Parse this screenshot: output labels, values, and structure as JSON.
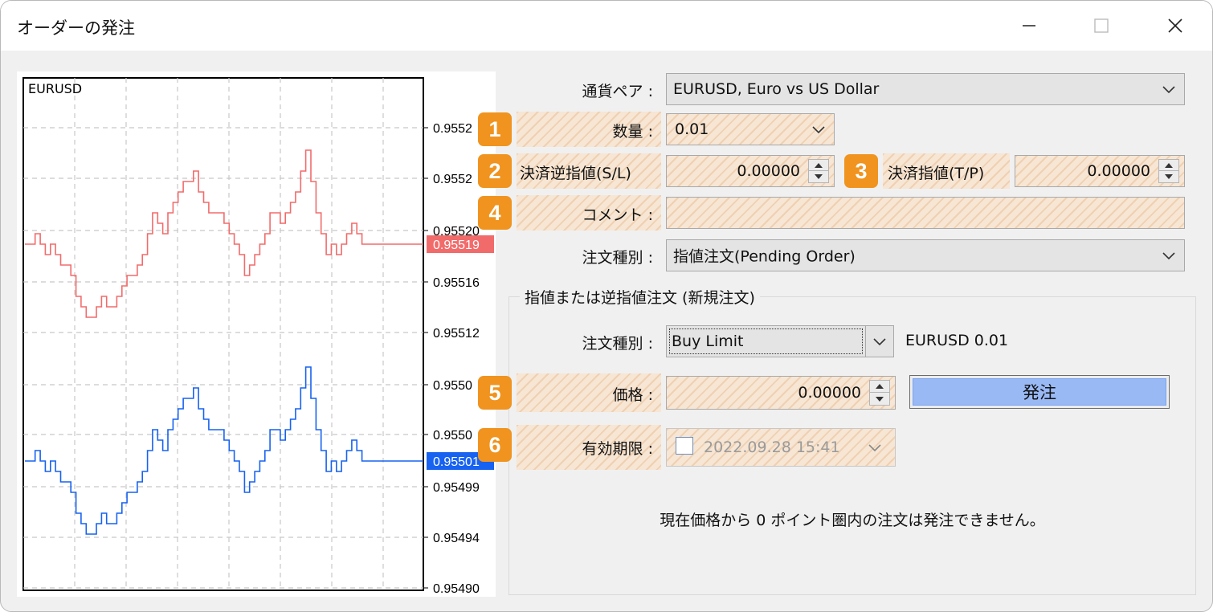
{
  "window": {
    "title": "オーダーの発注",
    "minimize_icon": "minimize-icon",
    "maximize_icon": "maximize-icon",
    "close_icon": "close-icon"
  },
  "colors": {
    "bid_line": "#f26b6b",
    "ask_line": "#1762f0",
    "badge": "#f0941f",
    "order_button": "#99b9f5"
  },
  "badges": [
    "1",
    "2",
    "3",
    "4",
    "5",
    "6"
  ],
  "form": {
    "symbol_label": "通貨ペア :",
    "symbol_value": "EURUSD, Euro vs US Dollar",
    "volume_label": "数量 :",
    "volume_value": "0.01",
    "sl_label": "決済逆指値(S/L)",
    "sl_value": "0.00000",
    "tp_label": "決済指値(T/P)",
    "tp_value": "0.00000",
    "comment_label": "コメント :",
    "comment_value": "",
    "type_label": "注文種別 :",
    "type_value": "指値注文(Pending Order)"
  },
  "pending": {
    "group_title": "指値または逆指値注文 (新規注文)",
    "order_type_label": "注文種別 :",
    "order_type_value": "Buy Limit",
    "order_summary": "EURUSD 0.01",
    "price_label": "価格 :",
    "price_value": "0.00000",
    "place_button": "発注",
    "expiry_label": "有効期限 :",
    "expiry_checked": false,
    "expiry_value": "2022.09.28 15:41",
    "notice": "現在価格から 0 ポイント圏内の注文は発注できません。"
  },
  "chart_data": {
    "type": "line",
    "title": "EURUSD",
    "y_ticks": [
      "0.95524",
      "0.95520",
      "0.95516",
      "0.95512",
      "0.95503",
      "0.95499",
      "0.95494",
      "0.95490"
    ],
    "y_tick_labels_display": [
      "0.9552",
      "0.9552",
      "0.95520",
      "0.95516",
      "0.95512",
      "0.9550",
      "0.9550",
      "0.95499",
      "0.95494",
      "0.95490"
    ],
    "bid_label": "0.95519",
    "ask_label": "0.95501",
    "grid": true,
    "series": [
      {
        "name": "Bid",
        "values": [
          0.95519,
          0.95519,
          0.9552,
          0.95519,
          0.95518,
          0.95519,
          0.95518,
          0.95517,
          0.95517,
          0.95516,
          0.95514,
          0.95513,
          0.95512,
          0.95512,
          0.95513,
          0.95514,
          0.95513,
          0.95513,
          0.95514,
          0.95515,
          0.95516,
          0.95516,
          0.95517,
          0.95518,
          0.9552,
          0.95522,
          0.95521,
          0.9552,
          0.95522,
          0.95523,
          0.95524,
          0.95525,
          0.95525,
          0.95526,
          0.95524,
          0.95523,
          0.95522,
          0.95522,
          0.95522,
          0.95521,
          0.9552,
          0.95519,
          0.95518,
          0.95516,
          0.95517,
          0.95518,
          0.95519,
          0.9552,
          0.95522,
          0.95522,
          0.95521,
          0.95522,
          0.95523,
          0.95524,
          0.95526,
          0.95528,
          0.95525,
          0.95522,
          0.9552,
          0.95518,
          0.95519,
          0.95518,
          0.95519,
          0.9552,
          0.95521,
          0.9552,
          0.95519,
          0.95519,
          0.95519,
          0.95519,
          0.95519
        ]
      },
      {
        "name": "Ask",
        "values": [
          0.95501,
          0.95501,
          0.95502,
          0.95501,
          0.955,
          0.95501,
          0.955,
          0.95499,
          0.95499,
          0.95498,
          0.95496,
          0.95495,
          0.95494,
          0.95494,
          0.95495,
          0.95496,
          0.95495,
          0.95495,
          0.95496,
          0.95497,
          0.95498,
          0.95498,
          0.95499,
          0.955,
          0.95502,
          0.95504,
          0.95503,
          0.95502,
          0.95504,
          0.95505,
          0.95506,
          0.95507,
          0.95507,
          0.95508,
          0.95506,
          0.95505,
          0.95504,
          0.95504,
          0.95504,
          0.95503,
          0.95502,
          0.95501,
          0.955,
          0.95498,
          0.95499,
          0.955,
          0.95501,
          0.95502,
          0.95504,
          0.95504,
          0.95503,
          0.95504,
          0.95505,
          0.95506,
          0.95508,
          0.9551,
          0.95507,
          0.95504,
          0.95502,
          0.955,
          0.95501,
          0.955,
          0.95501,
          0.95502,
          0.95503,
          0.95502,
          0.95501,
          0.95501,
          0.95501,
          0.95501,
          0.95501
        ]
      }
    ]
  }
}
